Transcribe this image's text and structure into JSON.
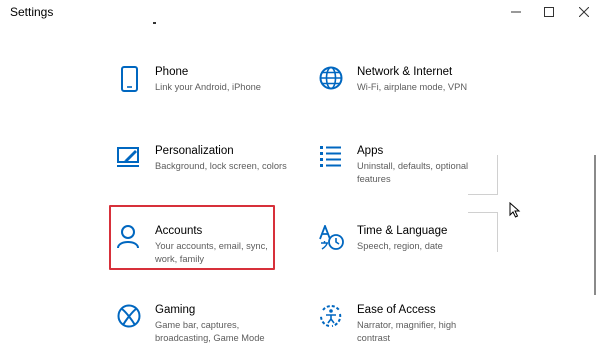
{
  "window": {
    "title": "Settings",
    "minimize_icon": "minimize-icon",
    "maximize_icon": "maximize-icon",
    "close_icon": "close-icon"
  },
  "tiles": {
    "phone": {
      "name": "Phone",
      "desc": "Link your Android, iPhone",
      "icon": "phone-icon"
    },
    "network": {
      "name": "Network & Internet",
      "desc": "Wi-Fi, airplane mode, VPN",
      "icon": "globe-icon"
    },
    "personalization": {
      "name": "Personalization",
      "desc": "Background, lock screen, colors",
      "icon": "paint-brush-icon"
    },
    "apps": {
      "name": "Apps",
      "desc": "Uninstall, defaults, optional features",
      "icon": "apps-list-icon"
    },
    "accounts": {
      "name": "Accounts",
      "desc": "Your accounts, email, sync, work, family",
      "icon": "person-icon"
    },
    "time": {
      "name": "Time & Language",
      "desc": "Speech, region, date",
      "icon": "time-language-icon"
    },
    "gaming": {
      "name": "Gaming",
      "desc": "Game bar, captures, broadcasting, Game Mode",
      "icon": "xbox-icon"
    },
    "ease": {
      "name": "Ease of Access",
      "desc": "Narrator, magnifier, high contrast",
      "icon": "ease-of-access-icon"
    }
  },
  "colors": {
    "accent": "#0067c0",
    "highlight": "#d7303a"
  }
}
